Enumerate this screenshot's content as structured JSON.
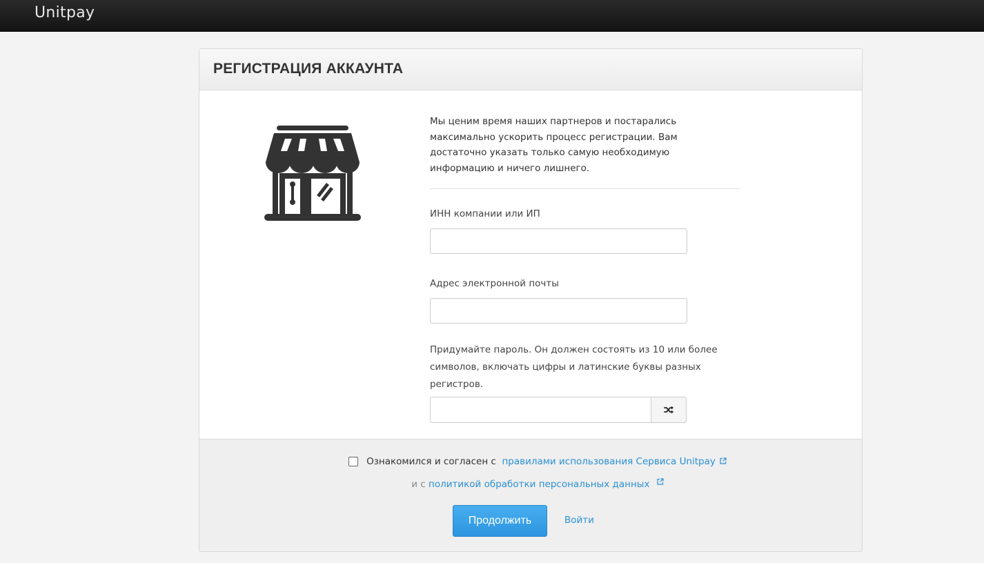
{
  "app": {
    "logo": "Unitpay"
  },
  "panel": {
    "title": "РЕГИСТРАЦИЯ АККАУНТА"
  },
  "form": {
    "intro": "Мы ценим время наших партнеров и постарались максимально ускорить процесс регистрации. Вам достаточно указать только самую необходимую информацию и ничего лишнего.",
    "inn_label": "ИНН компании или ИП",
    "inn_value": "",
    "email_label": "Адрес электронной почты",
    "email_value": "",
    "password_label": "Придумайте пароль. Он должен состоять из 10 или более символов, включать цифры и латинские буквы разных регистров.",
    "password_value": ""
  },
  "footer": {
    "agree_prefix": "Ознакомился и согласен с",
    "rules_link": "правилами использования Сервиса Unitpay",
    "and_with": "и с",
    "privacy_link": "политикой обработки персональных данных",
    "continue_label": "Продолжить",
    "login_label": "Войти"
  },
  "icons": {
    "store": "store-icon",
    "shuffle": "shuffle-icon",
    "external": "external-link-icon"
  },
  "colors": {
    "accent": "#2a8fd4",
    "button": "#38a3ea",
    "topbar": "#1e1e1e"
  }
}
